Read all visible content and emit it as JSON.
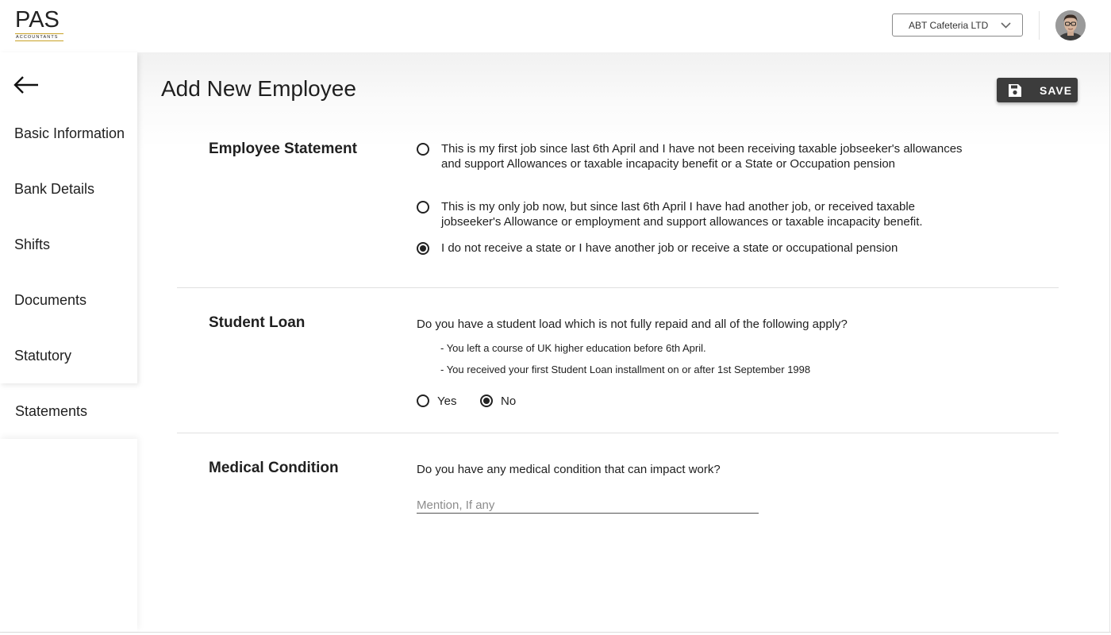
{
  "brand": {
    "logo_text": "PAS",
    "logo_subtext": "ACCOUNTANTS"
  },
  "header": {
    "company_select": {
      "value": "ABT Cafeteria LTD",
      "icon": "chevron-down-icon"
    },
    "avatar": "user-avatar"
  },
  "sidebar": {
    "back_icon": "arrow-left-icon",
    "items": [
      {
        "label": "Basic Information"
      },
      {
        "label": "Bank Details"
      },
      {
        "label": "Shifts"
      },
      {
        "label": "Documents"
      },
      {
        "label": "Statutory"
      },
      {
        "label": "Statements",
        "active": true
      }
    ]
  },
  "page": {
    "title": "Add New Employee",
    "save_label": "SAVE",
    "save_icon": "floppy-disk-icon"
  },
  "employee_statement": {
    "title": "Employee Statement",
    "selected": 2,
    "options": [
      {
        "label": "This is my first job since last 6th April and I have not been receiving taxable jobseeker's allowances and support Allowances or taxable incapacity benefit or a State or Occupation pension"
      },
      {
        "label": "This is my only job now, but since last 6th April I have had another job, or received taxable jobseeker's Allowance or employment and support allowances or taxable incapacity benefit."
      },
      {
        "label": "I do not receive a state or I have another job or receive a state or occupational pension"
      }
    ]
  },
  "student_loan": {
    "title": "Student Loan",
    "question": "Do you have a student load which is not fully repaid and all of the following apply?",
    "conditions": [
      "- You left a course of UK higher education before 6th April.",
      "- You received your first Student Loan installment on or after 1st September 1998"
    ],
    "options": [
      "Yes",
      "No"
    ],
    "selected": "No"
  },
  "medical_condition": {
    "title": "Medical Condition",
    "question": "Do you have any medical condition that can impact work?",
    "input_value": "",
    "placeholder": "Mention, If any"
  },
  "colors": {
    "save_button_bg": "#3c3c3c",
    "logo_accent": "#c9a227",
    "text": "#1f1f1f"
  }
}
